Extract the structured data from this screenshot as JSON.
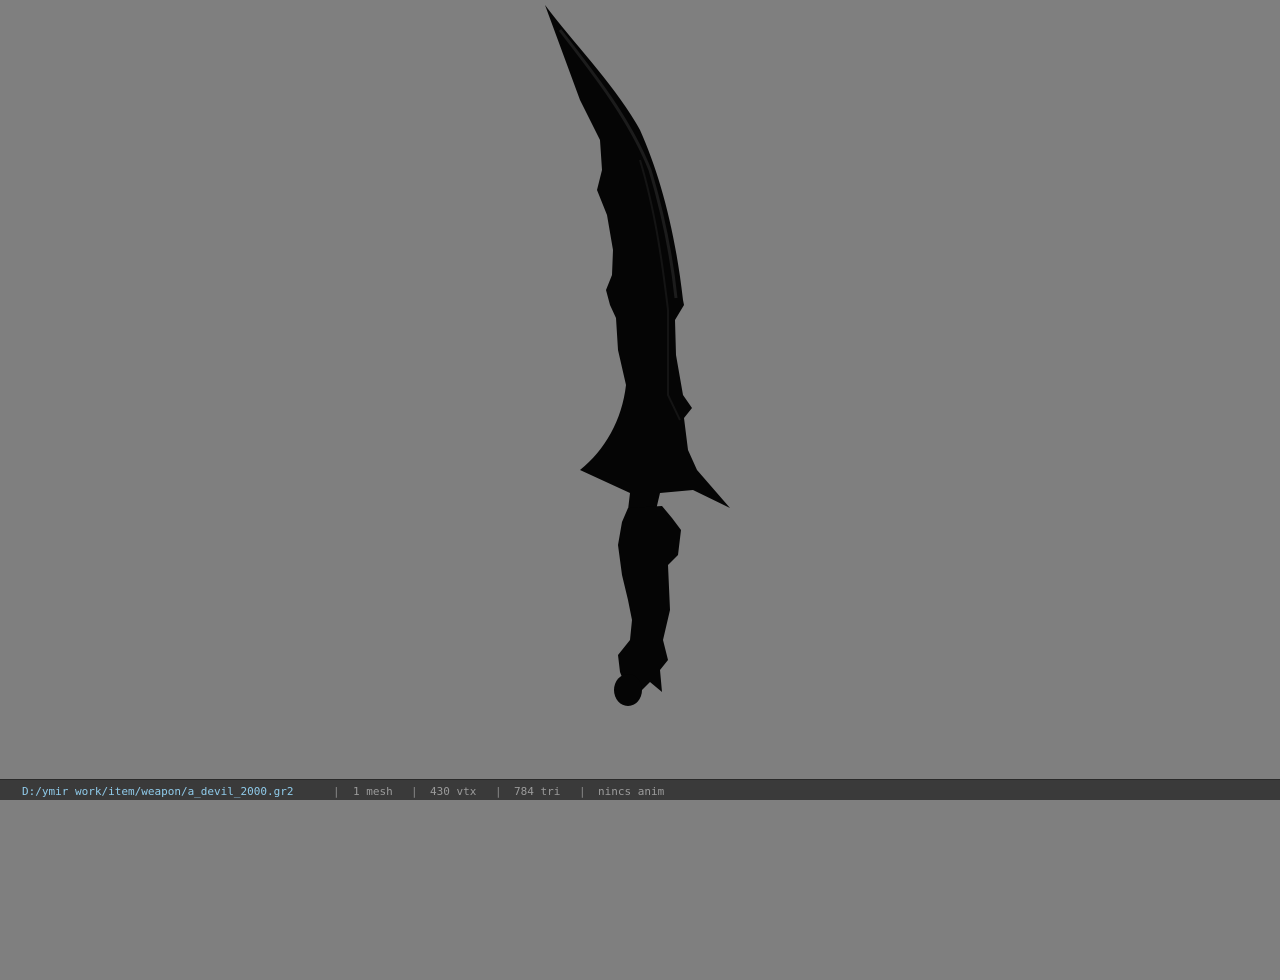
{
  "viewer": {
    "background_color": "#7f7f7f",
    "model_name": "dark curved scimitar weapon model",
    "model_color": "#050505"
  },
  "statusbar": {
    "file_path": "D:/ymir work/item/weapon/a_devil_2000.gr2",
    "separator": "|",
    "mesh_count": "1 mesh",
    "vertex_count": "430 vtx",
    "triangle_count": "784 tri",
    "animation": "nincs anim"
  }
}
